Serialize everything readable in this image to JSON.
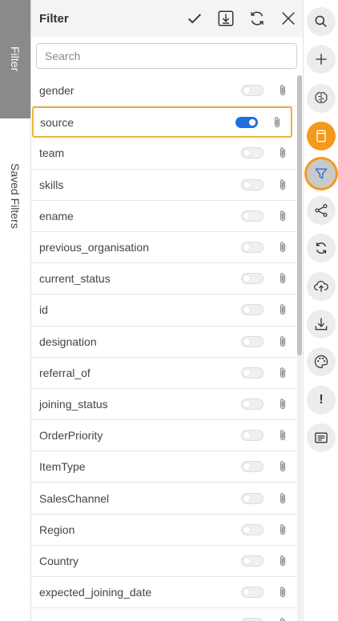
{
  "left_tabs": {
    "filter_tab": "Filter",
    "saved_filters_tab": "Saved Filters"
  },
  "panel": {
    "title": "Filter",
    "search_placeholder": "Search"
  },
  "filter_items": [
    {
      "label": "gender",
      "enabled": false
    },
    {
      "label": "source",
      "enabled": true,
      "selected": true
    },
    {
      "label": "team",
      "enabled": false
    },
    {
      "label": "skills",
      "enabled": false
    },
    {
      "label": "ename",
      "enabled": false
    },
    {
      "label": "previous_organisation",
      "enabled": false
    },
    {
      "label": "current_status",
      "enabled": false
    },
    {
      "label": "id",
      "enabled": false
    },
    {
      "label": "designation",
      "enabled": false
    },
    {
      "label": "referral_of",
      "enabled": false
    },
    {
      "label": "joining_status",
      "enabled": false
    },
    {
      "label": "OrderPriority",
      "enabled": false
    },
    {
      "label": "ItemType",
      "enabled": false
    },
    {
      "label": "SalesChannel",
      "enabled": false
    },
    {
      "label": "Region",
      "enabled": false
    },
    {
      "label": "Country",
      "enabled": false
    },
    {
      "label": "expected_joining_date",
      "enabled": false
    },
    {
      "label": "",
      "enabled": false
    }
  ],
  "toolbar": {
    "info_glyph": "!"
  },
  "colors": {
    "accent_orange": "#f39a1b",
    "toggle_on": "#1e6fe0",
    "selected_border": "#e7b33a",
    "active_tab": "#8a8a8a"
  },
  "icons": {
    "header": [
      "check-icon",
      "save-download-icon",
      "refresh-icon",
      "close-icon"
    ],
    "toolbar": [
      "search-icon",
      "plus-icon",
      "brain-icon",
      "note-icon",
      "filter-icon",
      "share-icon",
      "refresh-icon",
      "cloud-upload-icon",
      "download-icon",
      "palette-icon",
      "info-icon",
      "comment-icon"
    ]
  }
}
